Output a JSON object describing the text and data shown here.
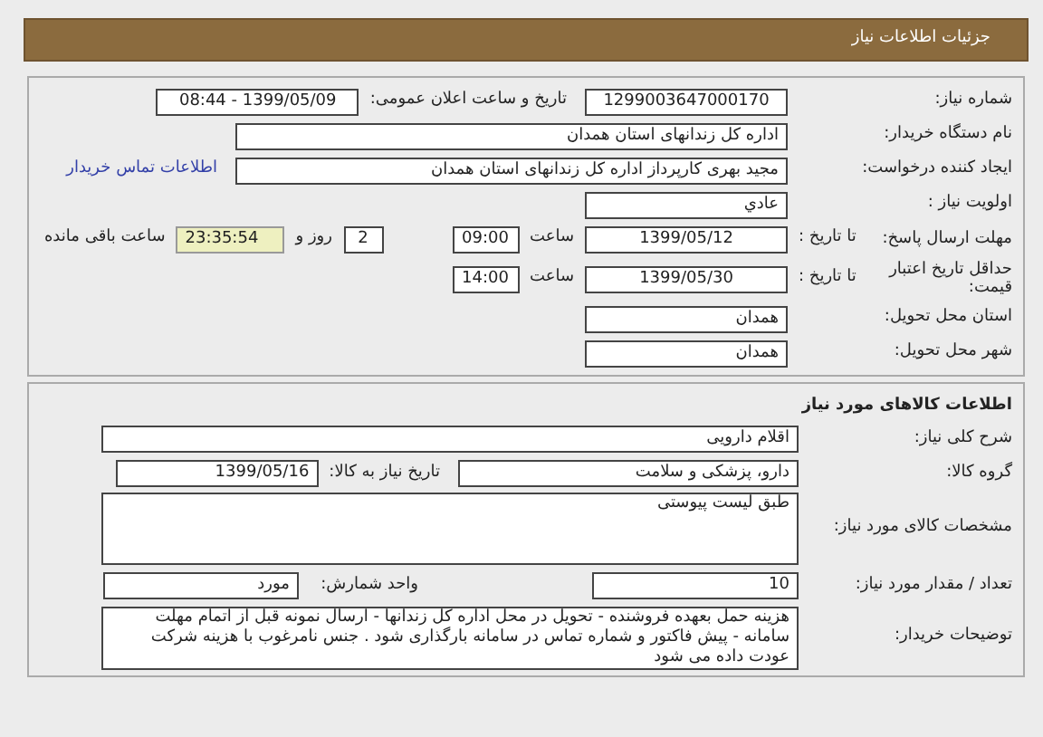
{
  "header": {
    "title": "جزئیات اطلاعات نیاز"
  },
  "need_info": {
    "need_number": {
      "label": "شماره نیاز:",
      "value": "1299003647000170"
    },
    "announce": {
      "label": "تاریخ و ساعت اعلان عمومی:",
      "value": "1399/05/09 - 08:44"
    },
    "buyer_org": {
      "label": "نام دستگاه خریدار:",
      "value": "اداره کل زندانهای استان همدان"
    },
    "requester": {
      "label": "ایجاد کننده درخواست:",
      "value": "مجید بهری کارپرداز اداره کل زندانهای استان همدان",
      "contact_link": "اطلاعات تماس خریدار"
    },
    "priority": {
      "label": "اولویت نیاز :",
      "value": "عادي"
    },
    "response_deadline": {
      "label": "مهلت ارسال پاسخ:",
      "to_date_label": "تا تاریخ :",
      "date": "1399/05/12",
      "time_label": "ساعت",
      "time": "09:00",
      "days": "2",
      "days_label": "روز و",
      "remaining": "23:35:54",
      "remaining_label": "ساعت باقی مانده"
    },
    "price_validity": {
      "label": "حداقل تاریخ اعتبار قیمت:",
      "to_date_label": "تا تاریخ :",
      "date": "1399/05/30",
      "time_label": "ساعت",
      "time": "14:00"
    },
    "province": {
      "label": "استان محل تحویل:",
      "value": "همدان"
    },
    "city": {
      "label": "شهر محل تحویل:",
      "value": "همدان"
    }
  },
  "goods": {
    "title": "اطلاعات کالاهای مورد نیاز",
    "summary": {
      "label": "شرح کلی نیاز:",
      "value": "اقلام دارویی"
    },
    "group": {
      "label": "گروه کالا:",
      "value": "دارو، پزشکی و سلامت"
    },
    "need_date": {
      "label": "تاریخ نیاز به کالا:",
      "value": "1399/05/16"
    },
    "specs": {
      "label": "مشخصات کالای مورد نیاز:",
      "value": "طبق لیست پیوستی"
    },
    "quantity": {
      "label": "تعداد / مقدار مورد نیاز:",
      "value": "10"
    },
    "unit": {
      "label": "واحد شمارش:",
      "value": "مورد"
    },
    "buyer_notes": {
      "label": "توضیحات خریدار:",
      "value": "هزینه حمل بعهده فروشنده - تحویل در محل اداره کل زندانها - ارسال نمونه قبل از اتمام مهلت سامانه - پیش فاکتور و شماره تماس در سامانه بارگذاری شود . جنس نامرغوب با هزینه شرکت عودت داده می شود"
    }
  }
}
